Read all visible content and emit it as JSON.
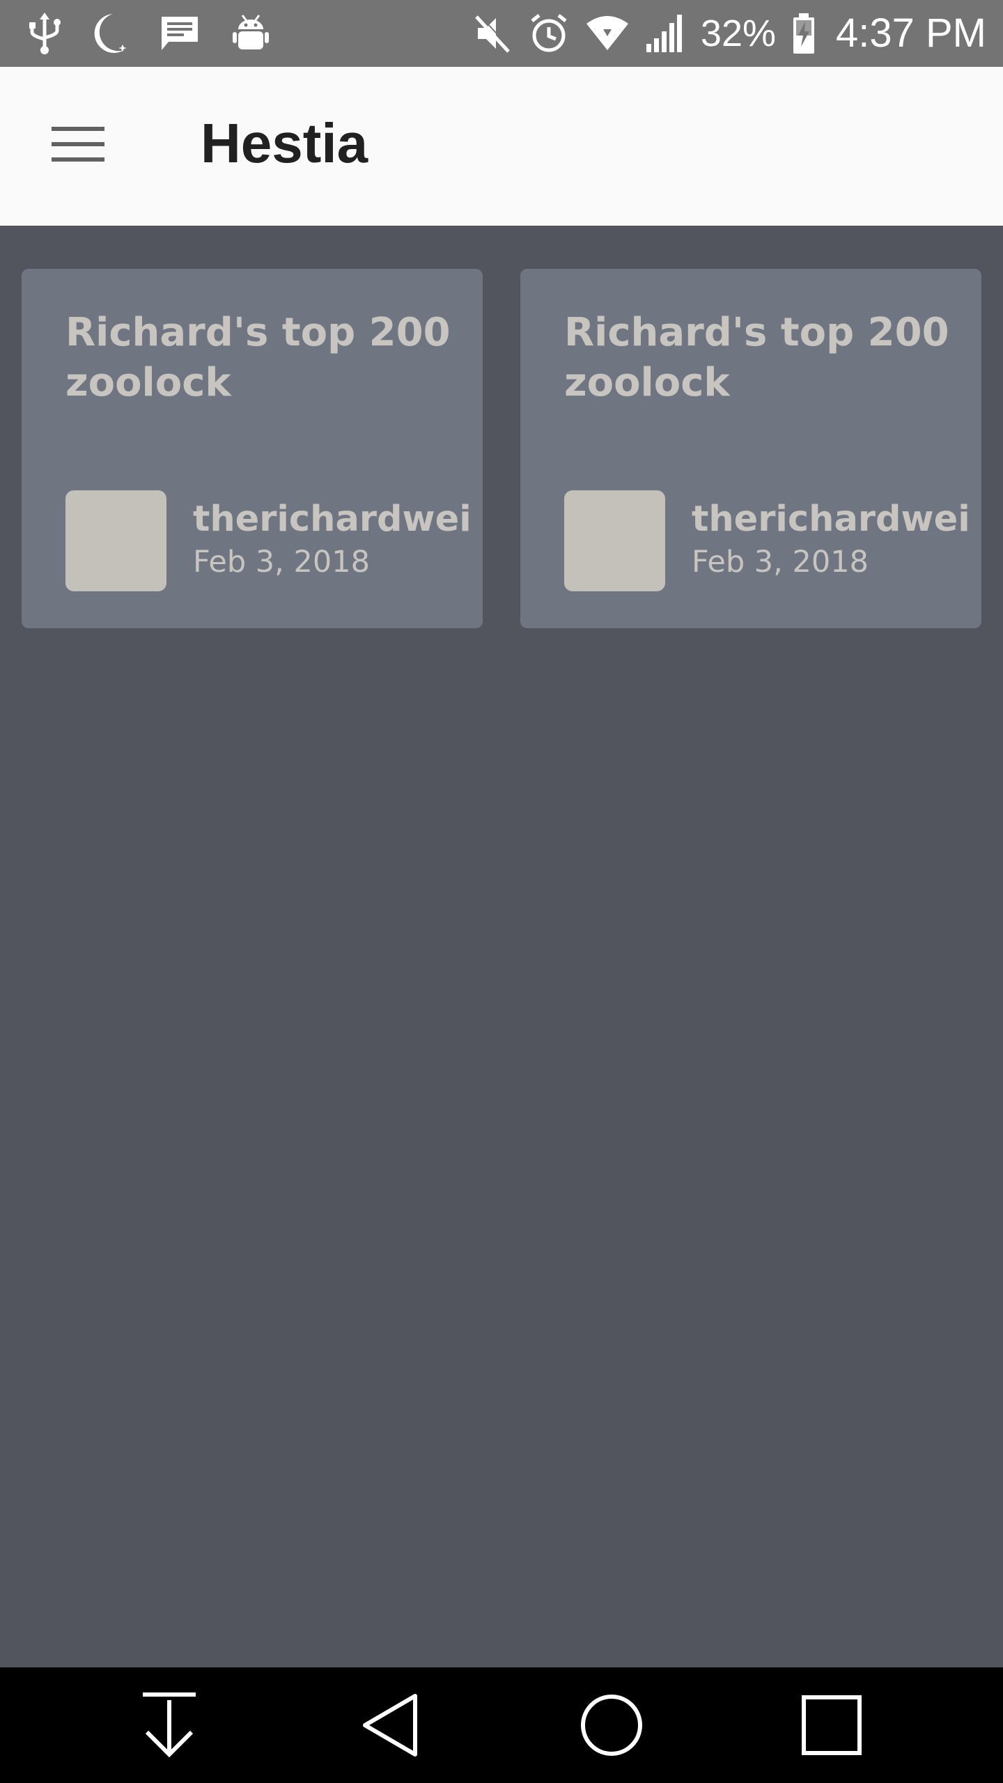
{
  "status_bar": {
    "left_icons": [
      "usb-icon",
      "moon-icon",
      "message-icon",
      "android-debug-icon"
    ],
    "right_icons": [
      "mute-icon",
      "alarm-icon",
      "wifi-icon",
      "signal-icon",
      "battery-charging-icon"
    ],
    "battery_percent": "32%",
    "time": "4:37 PM"
  },
  "app_bar": {
    "menu_icon": "hamburger-menu-icon",
    "title": "Hestia"
  },
  "cards": [
    {
      "title": "Richard's top 200 zoolock",
      "author": "therichardwei",
      "date": "Feb 3, 2018"
    },
    {
      "title": "Richard's top 200 zoolock",
      "author": "therichardwei",
      "date": "Feb 3, 2018"
    }
  ],
  "nav_bar": {
    "buttons": [
      "notification-pull-down-icon",
      "back-icon",
      "home-icon",
      "recent-apps-icon"
    ]
  },
  "colors": {
    "status_bar_bg": "#747474",
    "app_bar_bg": "#fafafa",
    "content_bg": "#52555e",
    "card_bg": "#6f7682",
    "card_text": "#c8c5c0",
    "avatar_placeholder": "#c4c1bb",
    "nav_bar_bg": "#000000"
  }
}
